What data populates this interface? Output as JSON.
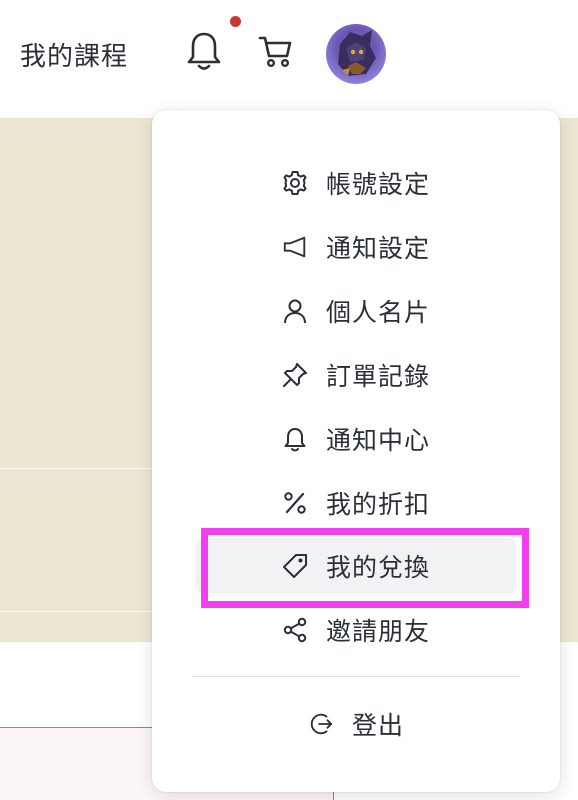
{
  "header": {
    "courses_label": "我的課程",
    "notification_icon": "bell-icon",
    "cart_icon": "cart-icon",
    "notification_dot_color": "#c9362b"
  },
  "menu": {
    "items": [
      {
        "label": "帳號設定",
        "icon": "gear-icon"
      },
      {
        "label": "通知設定",
        "icon": "megaphone-icon"
      },
      {
        "label": "個人名片",
        "icon": "user-icon"
      },
      {
        "label": "訂單記錄",
        "icon": "pin-icon"
      },
      {
        "label": "通知中心",
        "icon": "bell-icon"
      },
      {
        "label": "我的折扣",
        "icon": "percent-icon"
      },
      {
        "label": "我的兌換",
        "icon": "tag-icon"
      },
      {
        "label": "邀請朋友",
        "icon": "share-icon"
      }
    ],
    "logout": {
      "label": "登出",
      "icon": "logout-icon"
    },
    "active_item": "我的兌換",
    "highlight_color": "#f13ff0"
  }
}
